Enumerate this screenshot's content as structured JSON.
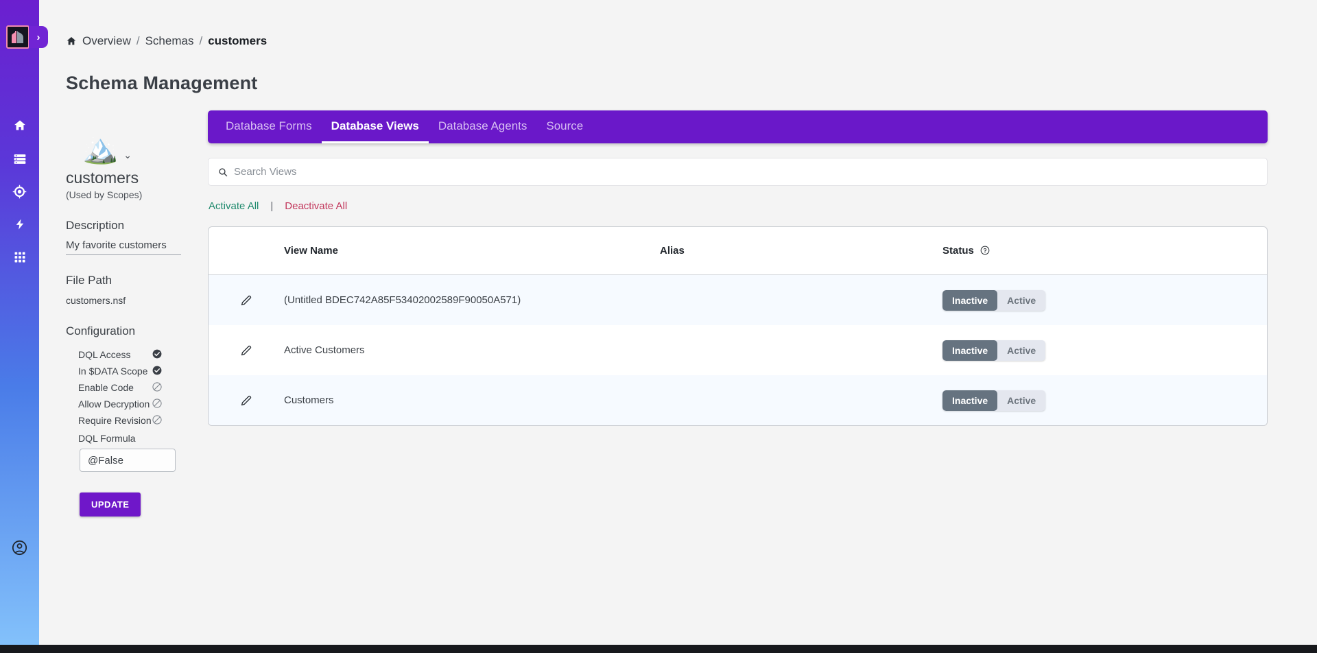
{
  "rail": {
    "logo_alt": "app-logo",
    "expand_label": "›",
    "items": [
      {
        "name": "home-icon",
        "label": "Home"
      },
      {
        "name": "database-icon",
        "label": "Databases"
      },
      {
        "name": "target-icon",
        "label": "Scopes"
      },
      {
        "name": "bolt-icon",
        "label": "Quick Actions"
      },
      {
        "name": "apps-grid-icon",
        "label": "Apps"
      }
    ],
    "account": {
      "name": "account-icon",
      "label": "Account"
    }
  },
  "breadcrumb": {
    "home_icon": "home-icon",
    "items": [
      {
        "label": "Overview",
        "current": false
      },
      {
        "label": "Schemas",
        "current": false
      },
      {
        "label": "customers",
        "current": true
      }
    ],
    "separator": "/"
  },
  "page": {
    "title": "Schema Management"
  },
  "detail": {
    "emoji": "🏔️",
    "chevron": "⌄",
    "schema_name": "customers",
    "schema_sub": "(Used by Scopes)",
    "description_label": "Description",
    "description_value": "My favorite customers",
    "filepath_label": "File Path",
    "filepath_value": "customers.nsf",
    "configuration_label": "Configuration",
    "config": [
      {
        "label": "DQL Access",
        "enabled": true
      },
      {
        "label": "In $DATA Scope",
        "enabled": true
      },
      {
        "label": "Enable Code",
        "enabled": false
      },
      {
        "label": "Allow Decryption",
        "enabled": false
      },
      {
        "label": "Require Revision",
        "enabled": false
      }
    ],
    "dql_formula_label": "DQL Formula",
    "dql_formula_value": "@False",
    "update_label": "UPDATE"
  },
  "tabs": [
    {
      "label": "Database Forms",
      "active": false
    },
    {
      "label": "Database Views",
      "active": true
    },
    {
      "label": "Database Agents",
      "active": false
    },
    {
      "label": "Source",
      "active": false
    }
  ],
  "search": {
    "icon": "search-icon",
    "placeholder": "Search Views",
    "value": ""
  },
  "bulk": {
    "activate_label": "Activate All",
    "separator": "|",
    "deactivate_label": "Deactivate All"
  },
  "table": {
    "columns": {
      "view_name": "View Name",
      "alias": "Alias",
      "status": "Status",
      "status_help_icon": "help-circle-icon"
    },
    "toggle": {
      "inactive": "Inactive",
      "active": "Active"
    },
    "rows": [
      {
        "edit_icon": "pencil-icon",
        "view_name": "(Untitled BDEC742A85F53402002589F90050A571)",
        "alias": "",
        "status": "Inactive"
      },
      {
        "edit_icon": "pencil-icon",
        "view_name": "Active Customers",
        "alias": "",
        "status": "Inactive"
      },
      {
        "edit_icon": "pencil-icon",
        "view_name": "Customers",
        "alias": "",
        "status": "Inactive"
      }
    ]
  },
  "colors": {
    "brand_purple": "#6A18C9",
    "rail_top": "#6B1FCF",
    "rail_bottom": "#83C1FB",
    "activate_green": "#1F8A6D",
    "deactivate_red": "#C2375C",
    "toggle_on_bg": "#667380",
    "page_bg": "#F4F4F4"
  }
}
